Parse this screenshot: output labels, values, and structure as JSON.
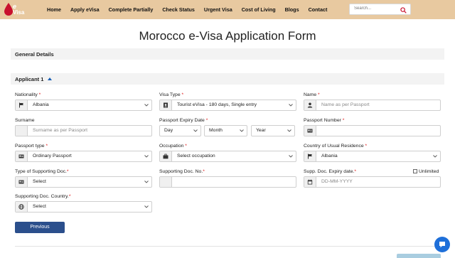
{
  "logo": {
    "e": "e",
    "visa": "Visa"
  },
  "nav": {
    "items": [
      "Home",
      "Apply eVisa",
      "Complete Partially",
      "Check Status",
      "Urgent Visa",
      "Cost of Living",
      "Blogs",
      "Contact"
    ]
  },
  "search": {
    "placeholder": "Search..."
  },
  "page": {
    "title": "Morocco e-Visa Application Form"
  },
  "sections": {
    "general": "General Details",
    "applicant": "Applicant 1"
  },
  "fields": {
    "nationality": {
      "label": "Nationality",
      "req": "*",
      "value": "Albania"
    },
    "visa_type": {
      "label": "Visa Type",
      "req": "*",
      "value": "Tourist eVisa - 180 days, Single entry"
    },
    "name": {
      "label": "Name",
      "req": "*",
      "placeholder": "Name as per Passport"
    },
    "surname": {
      "label": "Surname",
      "placeholder": "Surname as per Passport"
    },
    "passport_expiry": {
      "label": "Passport Expiry Date",
      "req": "*",
      "day": "Day",
      "month": "Month",
      "year": "Year"
    },
    "passport_number": {
      "label": "Passport Number",
      "req": "*"
    },
    "passport_type": {
      "label": "Passport type",
      "req": "*",
      "value": "Ordinary Passport"
    },
    "occupation": {
      "label": "Occupation",
      "req": "*",
      "value": "Select occupation"
    },
    "country_residence": {
      "label": "Country of Usual Residence",
      "req": "*",
      "value": "Albania"
    },
    "supporting_doc_type": {
      "label": "Type of Supporting Doc.",
      "req": "*",
      "value": "Select"
    },
    "supporting_doc_no": {
      "label": "Supporting Doc. No.",
      "req": "*"
    },
    "supp_doc_expiry": {
      "label": "Supp. Doc. Expiry date.",
      "req": "*",
      "placeholder": "DD-MM-YYYY",
      "unlimited": "Unlimited"
    },
    "supporting_doc_country": {
      "label": "Supporting Doc. Country.",
      "req": "*",
      "value": "Select"
    }
  },
  "buttons": {
    "previous": "Previous"
  },
  "colors": {
    "header_bg": "#e8c9a0",
    "primary_button": "#2b4f8c",
    "required": "#dd1111",
    "chat": "#1e6fd9"
  }
}
